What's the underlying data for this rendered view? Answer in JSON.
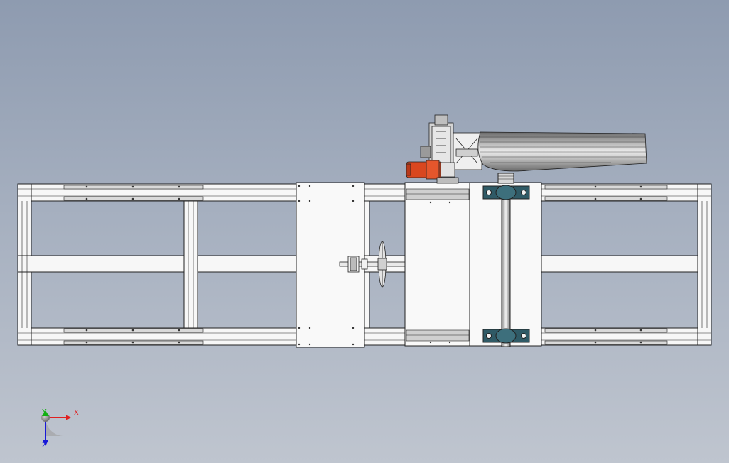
{
  "triad": {
    "x_label": "X",
    "y_label": "Y",
    "z_label": "Z",
    "x_color": "#e02020",
    "y_color": "#10b010",
    "z_color": "#1818d8"
  },
  "colors": {
    "background_top": "#8e9bb0",
    "background_bottom": "#bfc5cf",
    "frame": "#f7f7f7",
    "outline": "#222222",
    "motor": "#d9471f",
    "bearing_housing": "#2f5a66"
  }
}
